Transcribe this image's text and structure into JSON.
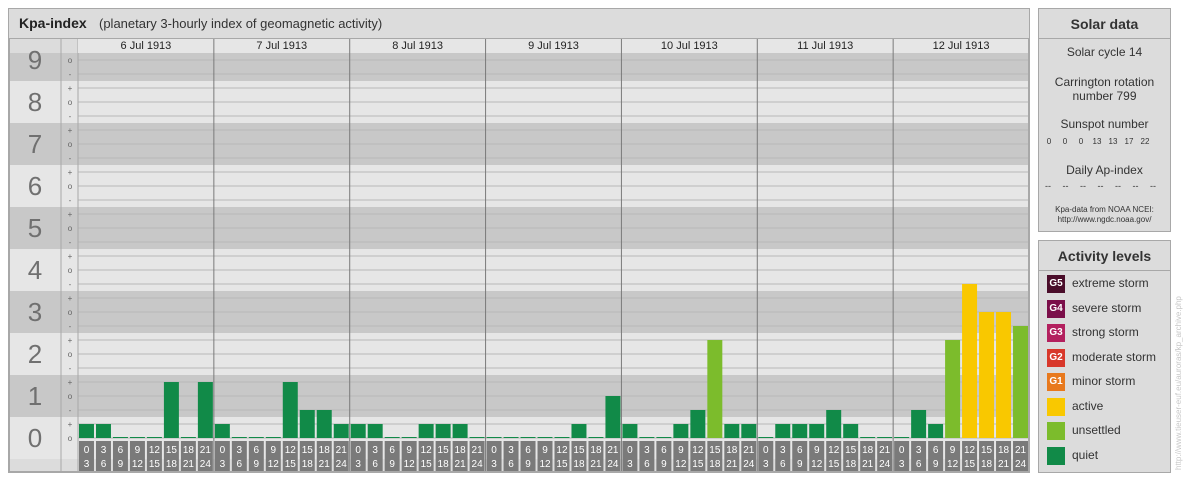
{
  "header": {
    "title": "Kpa-index",
    "subtitle": "(planetary 3-hourly index of geomagnetic activity)"
  },
  "chart_data": {
    "type": "bar",
    "y_range": [
      0,
      9
    ],
    "y_ticks": [
      "0",
      "1",
      "2",
      "3",
      "4",
      "5",
      "6",
      "7",
      "8",
      "9"
    ],
    "y_minor_labels": [
      "o",
      "+",
      "-"
    ],
    "days": [
      "6 Jul 1913",
      "7 Jul 1913",
      "8 Jul 1913",
      "9 Jul 1913",
      "10 Jul 1913",
      "11 Jul 1913",
      "12 Jul 1913"
    ],
    "interval_start_labels": [
      "0",
      "3",
      "6",
      "9",
      "12",
      "15",
      "18",
      "21"
    ],
    "interval_end_labels": [
      "3",
      "6",
      "9",
      "12",
      "15",
      "18",
      "21",
      "24"
    ],
    "values": [
      [
        0.333,
        0.333,
        0,
        0,
        0,
        1.333,
        0,
        1.333
      ],
      [
        0.333,
        0,
        0,
        0,
        1.333,
        0.667,
        0.667,
        0.333
      ],
      [
        0.333,
        0.333,
        0,
        0,
        0.333,
        0.333,
        0.333,
        0
      ],
      [
        0,
        0,
        0,
        0,
        0,
        0.333,
        0,
        1
      ],
      [
        0.333,
        0,
        0,
        0.333,
        0.667,
        2.333,
        0.333,
        0.333
      ],
      [
        0,
        0.333,
        0.333,
        0.333,
        0.667,
        0.333,
        0,
        0
      ],
      [
        0,
        0.667,
        0.333,
        2.333,
        3.667,
        3,
        3,
        2.667
      ]
    ],
    "colors": {
      "quiet": "#118a48",
      "unsettled": "#7cbc2c",
      "active": "#f9c800"
    }
  },
  "solar_data": {
    "title": "Solar data",
    "solar_cycle": "Solar cycle 14",
    "carrington_line1": "Carrington rotation",
    "carrington_line2": "number 799",
    "sunspot_title": "Sunspot number",
    "sunspot_values": [
      "0",
      "0",
      "0",
      "13",
      "13",
      "17",
      "22"
    ],
    "ap_title": "Daily Ap-index",
    "ap_values": [
      "--",
      "--",
      "--",
      "--",
      "--",
      "--",
      "--"
    ],
    "source_line1": "Kpa-data from NOAA NCEI:",
    "source_line2": "http://www.ngdc.noaa.gov/"
  },
  "activity_levels": {
    "title": "Activity levels",
    "items": [
      {
        "badge": "G5",
        "label": "extreme storm",
        "color": "#4a0d2a"
      },
      {
        "badge": "G4",
        "label": "severe storm",
        "color": "#7b0f4a"
      },
      {
        "badge": "G3",
        "label": "strong storm",
        "color": "#b3205e"
      },
      {
        "badge": "G2",
        "label": "moderate storm",
        "color": "#d8372a"
      },
      {
        "badge": "G1",
        "label": "minor storm",
        "color": "#e8791d"
      },
      {
        "badge": "",
        "label": "active",
        "color": "#f9c800"
      },
      {
        "badge": "",
        "label": "unsettled",
        "color": "#7cbc2c"
      },
      {
        "badge": "",
        "label": "quiet",
        "color": "#118a48"
      }
    ]
  },
  "watermark": "http://www.tieuser-euf.eu/auroras/kp_archive.php"
}
